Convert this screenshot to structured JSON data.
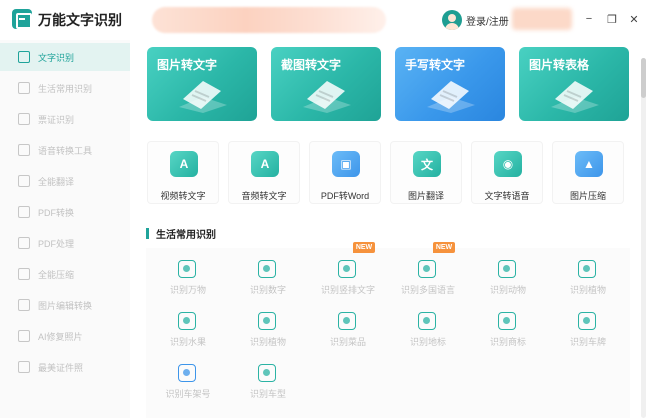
{
  "app": {
    "title": "万能文字识别",
    "login": "登录/注册",
    "window": {
      "minimize": "−",
      "restore": "❐",
      "close": "✕"
    }
  },
  "sidebar": {
    "items": [
      {
        "label": "文字识别",
        "active": true
      },
      {
        "label": "生活常用识别",
        "active": false
      },
      {
        "label": "票证识别",
        "active": false
      },
      {
        "label": "语音转换工具",
        "active": false
      },
      {
        "label": "全能翻译",
        "active": false
      },
      {
        "label": "PDF转换",
        "active": false
      },
      {
        "label": "PDF处理",
        "active": false
      },
      {
        "label": "全能压缩",
        "active": false
      },
      {
        "label": "图片编辑转换",
        "active": false
      },
      {
        "label": "AI修复照片",
        "active": false
      },
      {
        "label": "最美证件照",
        "active": false
      }
    ]
  },
  "banners": [
    {
      "title": "图片转文字",
      "color": "teal"
    },
    {
      "title": "截图转文字",
      "color": "teal"
    },
    {
      "title": "手写转文字",
      "color": "blue"
    },
    {
      "title": "图片转表格",
      "color": "teal"
    }
  ],
  "tools": [
    {
      "label": "视频转文字",
      "icon": "video-text-icon",
      "glyph": "A",
      "color": "teal"
    },
    {
      "label": "音频转文字",
      "icon": "audio-text-icon",
      "glyph": "A",
      "color": "teal"
    },
    {
      "label": "PDF转Word",
      "icon": "pdf-word-icon",
      "glyph": "▣",
      "color": "blue"
    },
    {
      "label": "图片翻译",
      "icon": "image-translate-icon",
      "glyph": "文",
      "color": "teal"
    },
    {
      "label": "文字转语音",
      "icon": "text-speech-icon",
      "glyph": "◉",
      "color": "teal"
    },
    {
      "label": "图片压缩",
      "icon": "image-compress-icon",
      "glyph": "▲",
      "color": "blue"
    }
  ],
  "life_section": {
    "title": "生活常用识别",
    "badge": "NEW",
    "items": [
      {
        "label": "识别万物",
        "icon": "eye-icon",
        "color": "teal"
      },
      {
        "label": "识别数字",
        "icon": "number-icon",
        "color": "teal"
      },
      {
        "label": "识别竖排文字",
        "icon": "vertical-text-icon",
        "color": "teal",
        "new": true
      },
      {
        "label": "识别多国语言",
        "icon": "language-icon",
        "color": "teal",
        "new": true
      },
      {
        "label": "识别动物",
        "icon": "animal-icon",
        "color": "teal"
      },
      {
        "label": "识别植物",
        "icon": "flower-icon",
        "color": "teal"
      },
      {
        "label": "识别水果",
        "icon": "fruit-icon",
        "color": "teal"
      },
      {
        "label": "识别植物",
        "icon": "plant-icon",
        "color": "teal"
      },
      {
        "label": "识别菜品",
        "icon": "dish-icon",
        "color": "teal"
      },
      {
        "label": "识别地标",
        "icon": "landmark-icon",
        "color": "teal"
      },
      {
        "label": "识别商标",
        "icon": "trademark-icon",
        "color": "teal"
      },
      {
        "label": "识别车牌",
        "icon": "license-plate-icon",
        "color": "teal"
      },
      {
        "label": "识别车架号",
        "icon": "vin-icon",
        "color": "blue"
      },
      {
        "label": "识别车型",
        "icon": "car-icon",
        "color": "teal"
      }
    ]
  }
}
